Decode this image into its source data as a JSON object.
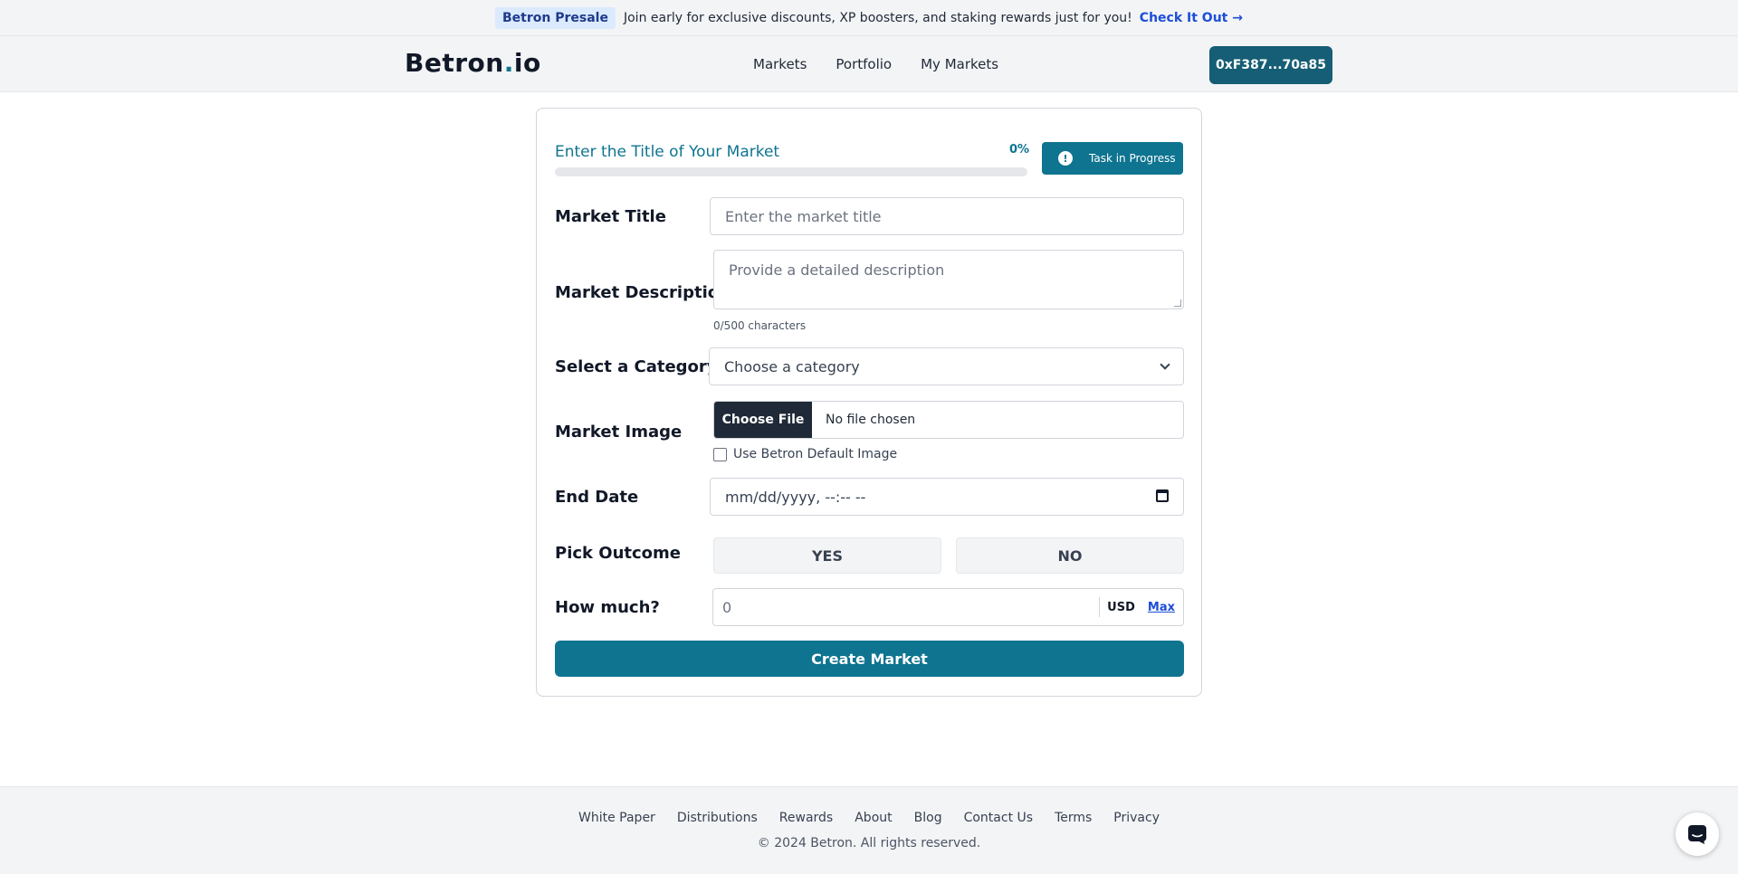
{
  "announcement": {
    "badge": "Betron Presale",
    "message": "Join early for exclusive discounts, XP boosters, and staking rewards just for you!",
    "cta": "Check It Out →"
  },
  "header": {
    "logo_main": "Betron",
    "logo_dot": ".",
    "logo_suffix": "io",
    "nav": [
      "Markets",
      "Portfolio",
      "My Markets"
    ],
    "wallet": "0xF387...70a85"
  },
  "progress": {
    "title": "Enter the Title of Your Market",
    "percent_label": "0%",
    "value": 0,
    "status_button": "Task in Progress",
    "status_icon": "!"
  },
  "form": {
    "title_label": "Market Title",
    "title_placeholder": "Enter the market title",
    "desc_label": "Market Description",
    "desc_placeholder": "Provide a detailed description",
    "char_count": "0/500 characters",
    "category_label": "Select a Category",
    "category_value": "Choose a category",
    "image_label": "Market Image",
    "file_button": "Choose File",
    "file_status": "No file chosen",
    "default_image_label": "Use Betron Default Image",
    "end_date_label": "End Date",
    "end_date_value": "mm/dd/yyyy, --:-- --",
    "outcome_label": "Pick Outcome",
    "outcome_yes": "YES",
    "outcome_no": "NO",
    "amount_label": "How much?",
    "amount_value": "0",
    "currency": "USD",
    "max": "Max",
    "submit": "Create Market"
  },
  "footer": {
    "links": [
      "White Paper",
      "Distributions",
      "Rewards",
      "About",
      "Blog",
      "Contact Us",
      "Terms",
      "Privacy"
    ],
    "copyright": "© 2024 Betron. All rights reserved."
  },
  "colors": {
    "accent": "#0e7490",
    "wallet": "#155e75",
    "dark_button": "#1f2937",
    "link": "#1d4ed8"
  },
  "icons": {
    "chat": "chat-bubble-icon",
    "calendar": "calendar-icon",
    "alert": "alert-circle-icon",
    "chevron": "chevron-down-icon"
  }
}
